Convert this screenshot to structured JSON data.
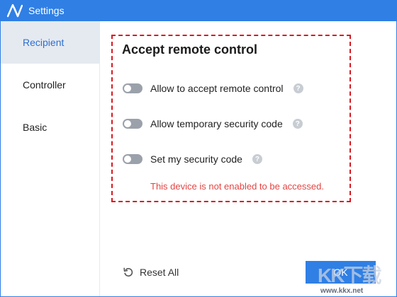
{
  "window": {
    "title": "Settings",
    "accent_color": "#2f7fe5"
  },
  "sidebar": {
    "items": [
      {
        "label": "Recipient",
        "active": true
      },
      {
        "label": "Controller",
        "active": false
      },
      {
        "label": "Basic",
        "active": false
      }
    ]
  },
  "main": {
    "section_title": "Accept remote control",
    "options": [
      {
        "label": "Allow to accept remote control",
        "enabled": false,
        "help_icon": "question-circle-icon"
      },
      {
        "label": "Allow temporary security code",
        "enabled": false,
        "help_icon": "question-circle-icon"
      },
      {
        "label": "Set my security code",
        "enabled": false,
        "help_icon": "question-circle-icon"
      }
    ],
    "warning": "This device is not enabled to be accessed.",
    "warning_color": "#e54343",
    "highlight_color": "#d9171f"
  },
  "footer": {
    "reset_label": "Reset All",
    "ok_label": "OK"
  },
  "watermark": {
    "letters": "KK下载",
    "url": "www.kkx.net"
  }
}
